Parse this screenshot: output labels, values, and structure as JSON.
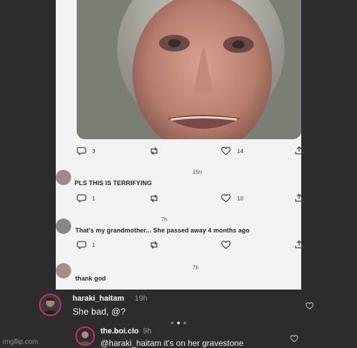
{
  "tweet": {
    "replies_count": "3",
    "likes_count": "14",
    "icons": [
      "reply-icon",
      "retweet-icon",
      "like-icon",
      "share-icon"
    ]
  },
  "comments": [
    {
      "time": "15h",
      "text": "PLS THIS IS TERRIFYING",
      "replies": "1",
      "likes": "10"
    },
    {
      "time": "7h",
      "text": "That's my grandmother... She passed away 4 months ago",
      "replies": "1"
    },
    {
      "time": "7h",
      "text": "thank god"
    }
  ],
  "ig_comments": [
    {
      "username": "haraki_haitam",
      "time": "19h",
      "text": "She bad, @?"
    },
    {
      "username": "the.boi.clo",
      "time": "9h",
      "text": "@haraki_haitam it's on her gravestone"
    }
  ],
  "watermark": "imgflip.com",
  "colors": {
    "background": "#2c2c2e",
    "panel": "#f3f3f3",
    "story_ring": "#d6296a"
  }
}
